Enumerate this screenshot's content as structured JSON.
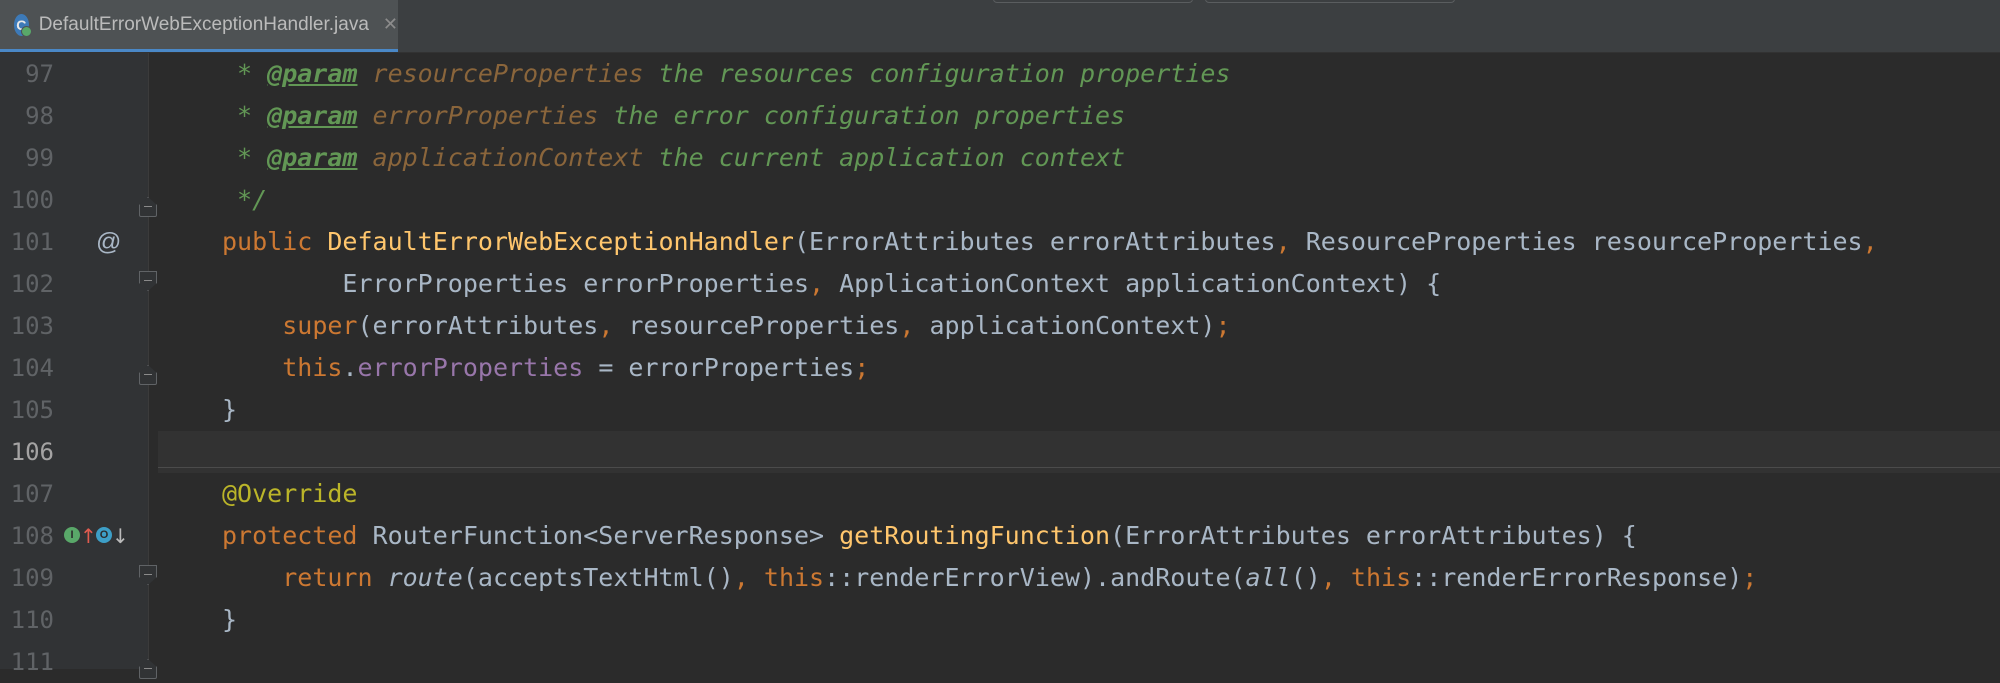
{
  "tab": {
    "icon_letter": "C",
    "title": "DefaultErrorWebExceptionHandler.java",
    "close_glyph": "✕"
  },
  "gutter_icons": {
    "annotation_marker": "@",
    "implements_icon": "implementing-method-icon",
    "overrides_icon": "overriding-method-icon",
    "implements_letter": "I",
    "overrides_letter": "O",
    "up_arrow": "↑",
    "down_arrow": "↓"
  },
  "lines": [
    {
      "n": "97"
    },
    {
      "n": "98"
    },
    {
      "n": "99"
    },
    {
      "n": "100"
    },
    {
      "n": "101"
    },
    {
      "n": "102"
    },
    {
      "n": "103"
    },
    {
      "n": "104"
    },
    {
      "n": "105"
    },
    {
      "n": "106"
    },
    {
      "n": "107"
    },
    {
      "n": "108"
    },
    {
      "n": "109"
    },
    {
      "n": "110"
    },
    {
      "n": "111"
    }
  ],
  "code": {
    "l97": {
      "star": " * ",
      "tag": "@param",
      "param": "resourceProperties",
      "text": " the resources configuration properties"
    },
    "l98": {
      "star": " * ",
      "tag": "@param",
      "param": "errorProperties",
      "text": " the error configuration properties"
    },
    "l99": {
      "star": " * ",
      "tag": "@param",
      "param": "applicationContext",
      "text": " the current application context"
    },
    "l100": {
      "text": " */"
    },
    "l101": {
      "kw": "public ",
      "fn": "DefaultErrorWebExceptionHandler",
      "p1": "(ErrorAttributes errorAttributes",
      "c1": ", ",
      "p2": "ResourceProperties resourceProperties",
      "c2": ","
    },
    "l102": {
      "indent": "        ",
      "p1": "ErrorProperties errorProperties",
      "c1": ", ",
      "p2": "ApplicationContext applicationContext) {"
    },
    "l103": {
      "indent": "    ",
      "kw": "super",
      "p1": "(errorAttributes",
      "c1": ", ",
      "p2": "resourceProperties",
      "c2": ", ",
      "p3": "applicationContext)",
      "semi": ";"
    },
    "l104": {
      "indent": "    ",
      "kw": "this",
      "dot": ".",
      "fld": "errorProperties",
      "rest": " = errorProperties",
      "semi": ";"
    },
    "l105": {
      "text": "}"
    },
    "l107": {
      "ann": "@Override"
    },
    "l108": {
      "kw": "protected ",
      "type": "RouterFunction<ServerResponse> ",
      "fn": "getRoutingFunction",
      "rest": "(ErrorAttributes errorAttributes) {"
    },
    "l109": {
      "indent": "    ",
      "kw": "return ",
      "route": "route",
      "a": "(acceptsTextHtml()",
      "c1": ", ",
      "this1": "this",
      "b": "::renderErrorView).andRoute(",
      "all": "all",
      "c": "()",
      "c2": ", ",
      "this2": "this",
      "d": "::renderErrorResponse)",
      "semi": ";"
    },
    "l110": {
      "text": "}"
    }
  }
}
